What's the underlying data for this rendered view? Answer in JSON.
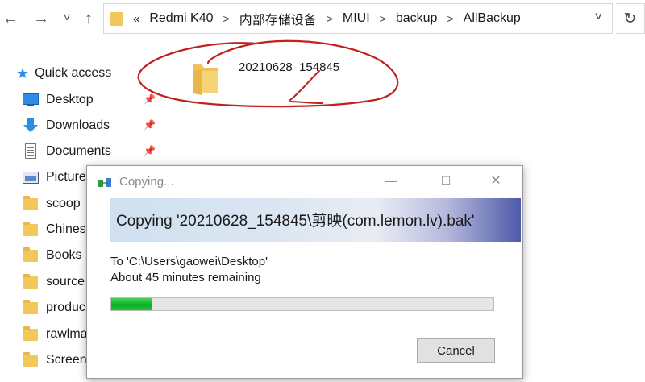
{
  "window": {
    "title": "Copying..."
  },
  "nav": {
    "back": "←",
    "forward": "→",
    "recent": "˅",
    "up": "↑"
  },
  "address": {
    "overflow": "«",
    "crumbs": [
      "Redmi K40",
      "内部存储设备",
      "MIUI",
      "backup",
      "AllBackup"
    ],
    "separator": ">",
    "dropdown": "˅",
    "refresh": "↻"
  },
  "sidebar": {
    "quick_access": "Quick access",
    "items": [
      {
        "label": "Desktop",
        "icon": "desktop-icon",
        "pinned": true
      },
      {
        "label": "Downloads",
        "icon": "downloads-icon",
        "pinned": true
      },
      {
        "label": "Documents",
        "icon": "documents-icon",
        "pinned": true
      },
      {
        "label": "Picture",
        "icon": "pictures-icon",
        "pinned": false
      },
      {
        "label": "scoop",
        "icon": "folder-icon",
        "pinned": false
      },
      {
        "label": "Chines",
        "icon": "folder-icon",
        "pinned": false
      },
      {
        "label": "Books",
        "icon": "folder-icon",
        "pinned": false
      },
      {
        "label": "source",
        "icon": "folder-icon",
        "pinned": false
      },
      {
        "label": "produc",
        "icon": "folder-icon",
        "pinned": false
      },
      {
        "label": "rawlma",
        "icon": "folder-icon",
        "pinned": false
      },
      {
        "label": "Screen",
        "icon": "folder-icon",
        "pinned": false
      }
    ]
  },
  "content": {
    "folder_name": "20210628_154845"
  },
  "dialog": {
    "title": "Copying...",
    "heading": "Copying '20210628_154845\\剪映(com.lemon.lv).bak'",
    "destination": "To 'C:\\Users\\gaowei\\Desktop'",
    "remaining": "About 45 minutes remaining",
    "progress": 0.105,
    "cancel_label": "Cancel",
    "minimize": "—",
    "maximize": "☐",
    "close": "✕"
  },
  "colors": {
    "annotation": "#c0211f",
    "progress": "#06b025",
    "accent": "#0078d7"
  }
}
